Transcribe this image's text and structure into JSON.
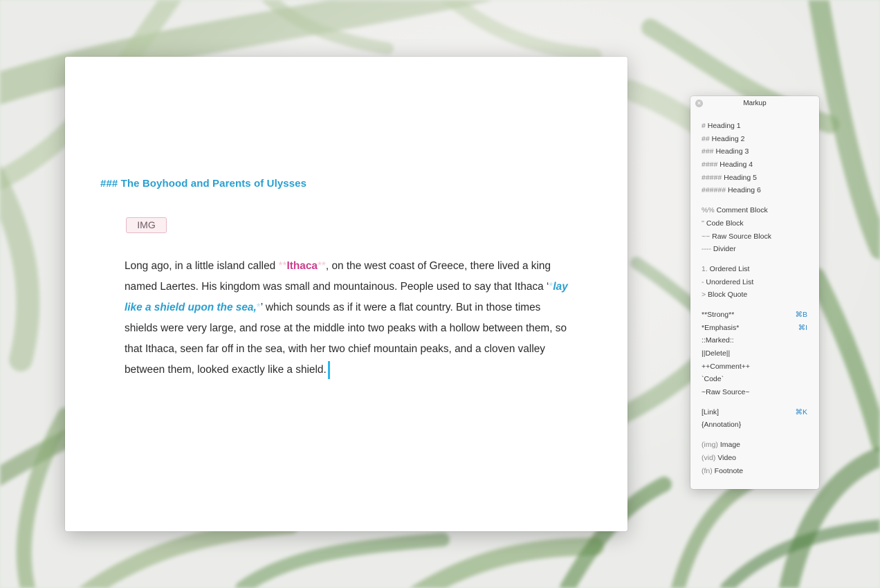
{
  "editor": {
    "heading": "### The Boyhood and Parents of Ulysses",
    "img_tag": "IMG",
    "paragraph": {
      "t1": "Long ago, in a little island called ",
      "strong_open": "**",
      "strong_text": "Ithaca",
      "strong_close": "**",
      "t2": ", on the west coast of Greece, there lived a king named Laertes. His kingdom was small and mountainous. People used to say that Ithaca ‘",
      "em_open": "*",
      "em_text": "lay like a shield upon the sea,",
      "em_close": "*",
      "t3": "’ which sounds as if it were a flat country. But in those times shields were very large, and rose at the middle into two peaks with a hollow between them, so that Ithaca, seen far off in the sea, with her two chief mountain peaks, and a cloven valley between them, looked exactly like a shield."
    }
  },
  "palette": {
    "title": "Markup",
    "close_icon": "×",
    "groups": {
      "headings": [
        {
          "mark": "#",
          "label": " Heading 1"
        },
        {
          "mark": "##",
          "label": " Heading 2"
        },
        {
          "mark": "###",
          "label": " Heading 3"
        },
        {
          "mark": "####",
          "label": " Heading 4"
        },
        {
          "mark": "#####",
          "label": " Heading 5"
        },
        {
          "mark": "######",
          "label": " Heading 6"
        }
      ],
      "blocks": [
        {
          "mark": "%%",
          "label": " Comment Block"
        },
        {
          "mark": "''",
          "label": " Code Block"
        },
        {
          "mark": "~~",
          "label": " Raw Source Block"
        },
        {
          "mark": "----",
          "label": " Divider"
        }
      ],
      "lists": [
        {
          "mark": "1.",
          "label": " Ordered List"
        },
        {
          "mark": "-",
          "label": " Unordered List"
        },
        {
          "mark": ">",
          "label": " Block Quote"
        }
      ],
      "inline": [
        {
          "label": "**Strong**",
          "shortcut": "⌘B"
        },
        {
          "label": "*Emphasis*",
          "shortcut": "⌘I"
        },
        {
          "label": "::Marked::"
        },
        {
          "label": "||Delete||"
        },
        {
          "label": "++Comment++"
        },
        {
          "label": "`Code`"
        },
        {
          "label": "~Raw Source~"
        }
      ],
      "links": [
        {
          "label": "[Link]",
          "shortcut": "⌘K"
        },
        {
          "label": "{Annotation}"
        }
      ],
      "media": [
        {
          "mark": "(img)",
          "label": " Image"
        },
        {
          "mark": "(vid)",
          "label": " Video"
        },
        {
          "mark": "(fn)",
          "label": " Footnote"
        }
      ]
    }
  },
  "colors": {
    "accent_blue": "#2a9fd0",
    "strong_pink": "#cd3d8b",
    "caret": "#2cb6ec",
    "shortcut_blue": "#2a88c8"
  }
}
